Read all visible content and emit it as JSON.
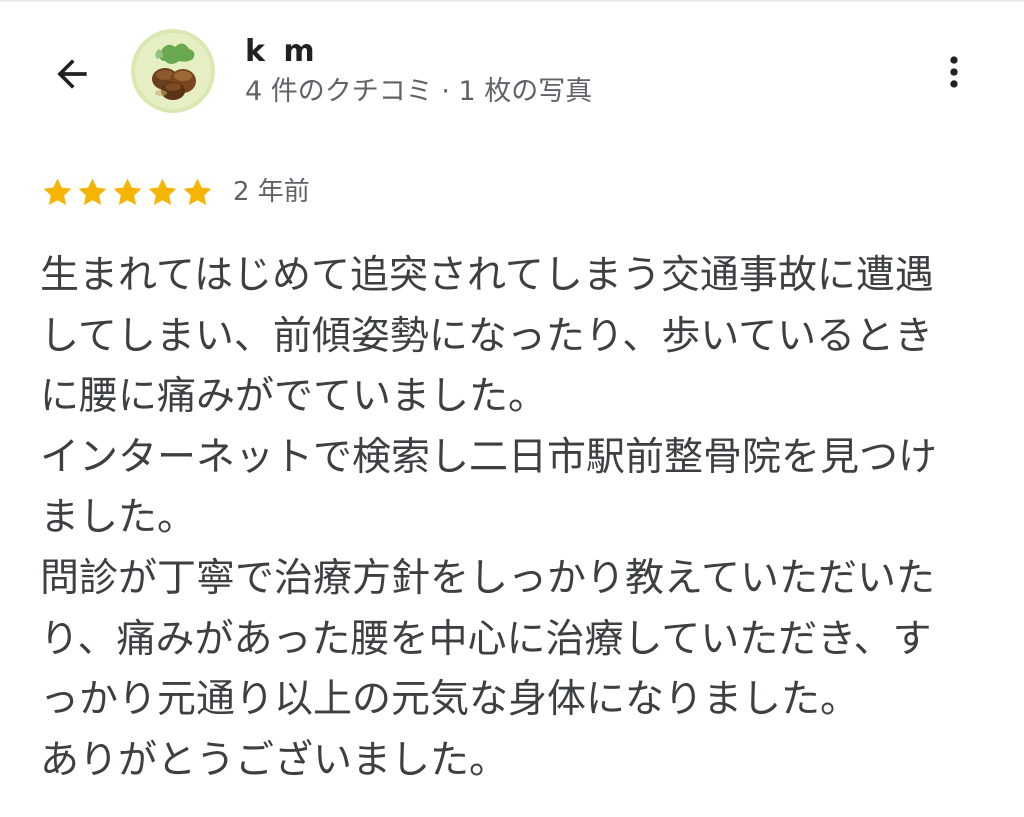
{
  "header": {
    "user_name": "k m",
    "user_meta": "4 件のクチコミ · 1 枚の写真"
  },
  "review": {
    "rating": 5,
    "max_rating": 5,
    "date": "2 年前",
    "lines": [
      "生まれてはじめて追突されてしまう交通事故に遭遇",
      "してしまい、前傾姿勢になったり、歩いているとき",
      "に腰に痛みがでていました。",
      "インターネットで検索し二日市駅前整骨院を見つけ",
      "ました。",
      "問診が丁寧で治療方針をしっかり教えていただいた",
      "り、痛みがあった腰を中心に治療していただき、す",
      "っかり元通り以上の元気な身体になりました。",
      "ありがとうございました。"
    ]
  },
  "colors": {
    "star": "#f5b400",
    "text": "#3c4043",
    "meta": "#5f6368",
    "icon": "#202124"
  },
  "icons": {
    "back": "arrow-back-icon",
    "more": "more-vert-icon"
  }
}
